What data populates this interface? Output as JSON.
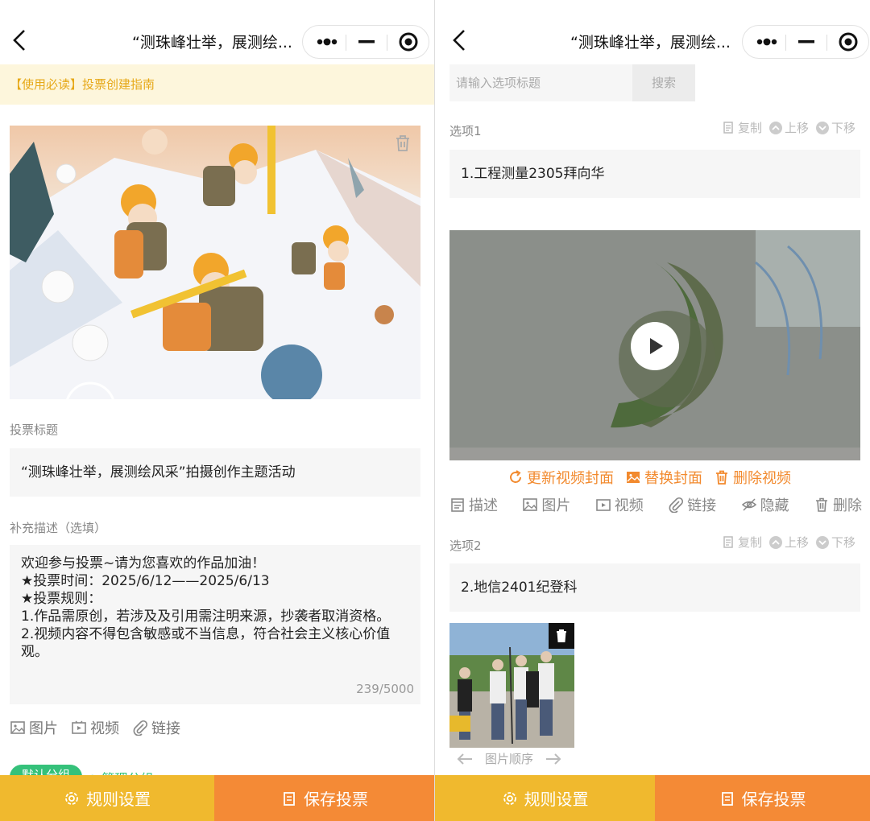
{
  "nav": {
    "title": "“测珠峰壮举，展测绘..."
  },
  "left": {
    "notice": "【使用必读】投票创建指南",
    "vote_title_label": "投票标题",
    "vote_title_value": "“测珠峰壮举，展测绘风采”拍摄创作主题活动",
    "desc_label": "补充描述（选填）",
    "desc_lines": "欢迎参与投票~请为您喜欢的作品加油！\n★投票时间：2025/6/12——2025/6/13\n★投票规则：\n1.作品需原创，若涉及及引用需注明来源，抄袭者取消资格。\n2.视频内容不得包含敏感或不当信息，符合社会主义核心价值观。",
    "desc_count": "239/5000",
    "tools": {
      "image": "图片",
      "video": "视频",
      "link": "链接"
    },
    "group_pill": "默认分组",
    "manage_group": "管理分组"
  },
  "right": {
    "search_placeholder": "请输入选项标题",
    "search_button": "搜索",
    "option1": {
      "label": "选项1",
      "title": "1.工程测量2305拜向华"
    },
    "option2": {
      "label": "选项2",
      "title": "2.地信2401纪登科"
    },
    "option_actions": {
      "copy": "复制",
      "up": "上移",
      "down": "下移"
    },
    "video_actions": {
      "update_cover": "更新视频封面",
      "replace_cover": "替换封面",
      "delete_video": "删除视频"
    },
    "tools": {
      "desc": "描述",
      "image": "图片",
      "video": "视频",
      "link": "链接",
      "hide": "隐藏",
      "delete": "删除"
    },
    "image_order": "图片顺序"
  },
  "bottom": {
    "rules": "规则设置",
    "save": "保存投票"
  },
  "colors": {
    "notice_text": "#e6a817",
    "rules_bg": "#f0b92e",
    "save_bg": "#f48a36",
    "video_action": "#f28a2e",
    "group_green": "#35c17a"
  }
}
